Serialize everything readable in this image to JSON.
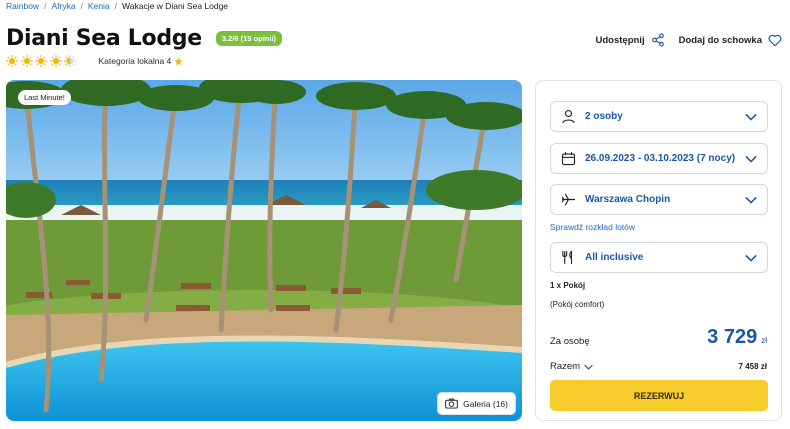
{
  "breadcrumb": {
    "items": [
      "Rainbow",
      "Afryka",
      "Kenia"
    ],
    "current": "Wakacje w Diani Sea Lodge"
  },
  "hotel": {
    "name": "Diani Sea Lodge",
    "rating_badge": "3.2/6 (15 opinii)",
    "suns": 4.5,
    "category_label": "Kategoria lokalna 4"
  },
  "actions": {
    "share": "Udostępnij",
    "favorite": "Dodaj do schowka"
  },
  "photo": {
    "badge": "Last Minute!",
    "gallery": "Galeria (16)"
  },
  "booking": {
    "travelers": "2 osoby",
    "dates": "26.09.2023 - 03.10.2023 (7 nocy)",
    "airport": "Warszawa Chopin",
    "flight_link": "Sprawdź rozkład lotów",
    "board": "All inclusive",
    "room_count": "1 x Pokój",
    "room_type": "(Pokój comfort)",
    "per_person_label": "Za osobę",
    "per_person_price": "3 729",
    "currency": "zł",
    "total_label": "Razem",
    "total_price": "7 458 zł",
    "book_button": "REZERWUJ"
  },
  "colors": {
    "accent_blue": "#1a56a6",
    "link_blue": "#1f67c4",
    "badge_green": "#7cbf3f",
    "sun_yellow": "#f6b40e",
    "book_yellow": "#f5cc2b"
  }
}
